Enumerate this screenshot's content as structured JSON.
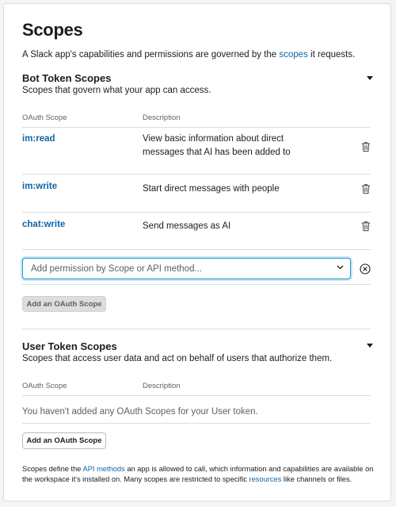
{
  "page": {
    "title": "Scopes",
    "intro_before": "A Slack app's capabilities and permissions are governed by the ",
    "intro_link": "scopes",
    "intro_after": " it requests."
  },
  "bot_section": {
    "title": "Bot Token Scopes",
    "subtitle": "Scopes that govern what your app can access.",
    "col_scope": "OAuth Scope",
    "col_desc": "Description",
    "rows": [
      {
        "scope": "im:read",
        "description": "View basic information about direct messages that AI has been added to"
      },
      {
        "scope": "im:write",
        "description": "Start direct messages with people"
      },
      {
        "scope": "chat:write",
        "description": "Send messages as AI"
      }
    ],
    "input_placeholder": "Add permission by Scope or API method...",
    "add_button": "Add an OAuth Scope"
  },
  "user_section": {
    "title": "User Token Scopes",
    "subtitle": "Scopes that access user data and act on behalf of users that authorize them.",
    "col_scope": "OAuth Scope",
    "col_desc": "Description",
    "empty_text": "You haven't added any OAuth Scopes for your User token.",
    "add_button": "Add an OAuth Scope"
  },
  "footer": {
    "part1": "Scopes define the ",
    "link1": "API methods",
    "part2": " an app is allowed to call, which information and capabilities are available on the workspace it's installed on. Many scopes are restricted to specific ",
    "link2": "resources",
    "part3": " like channels or files."
  },
  "colors": {
    "link": "#1264a3",
    "focus_border": "#1d9bd1",
    "divider": "#dddddd"
  },
  "icons": [
    "caret-down-icon",
    "trash-icon",
    "chevron-down-icon",
    "clear-circle-x-icon"
  ]
}
